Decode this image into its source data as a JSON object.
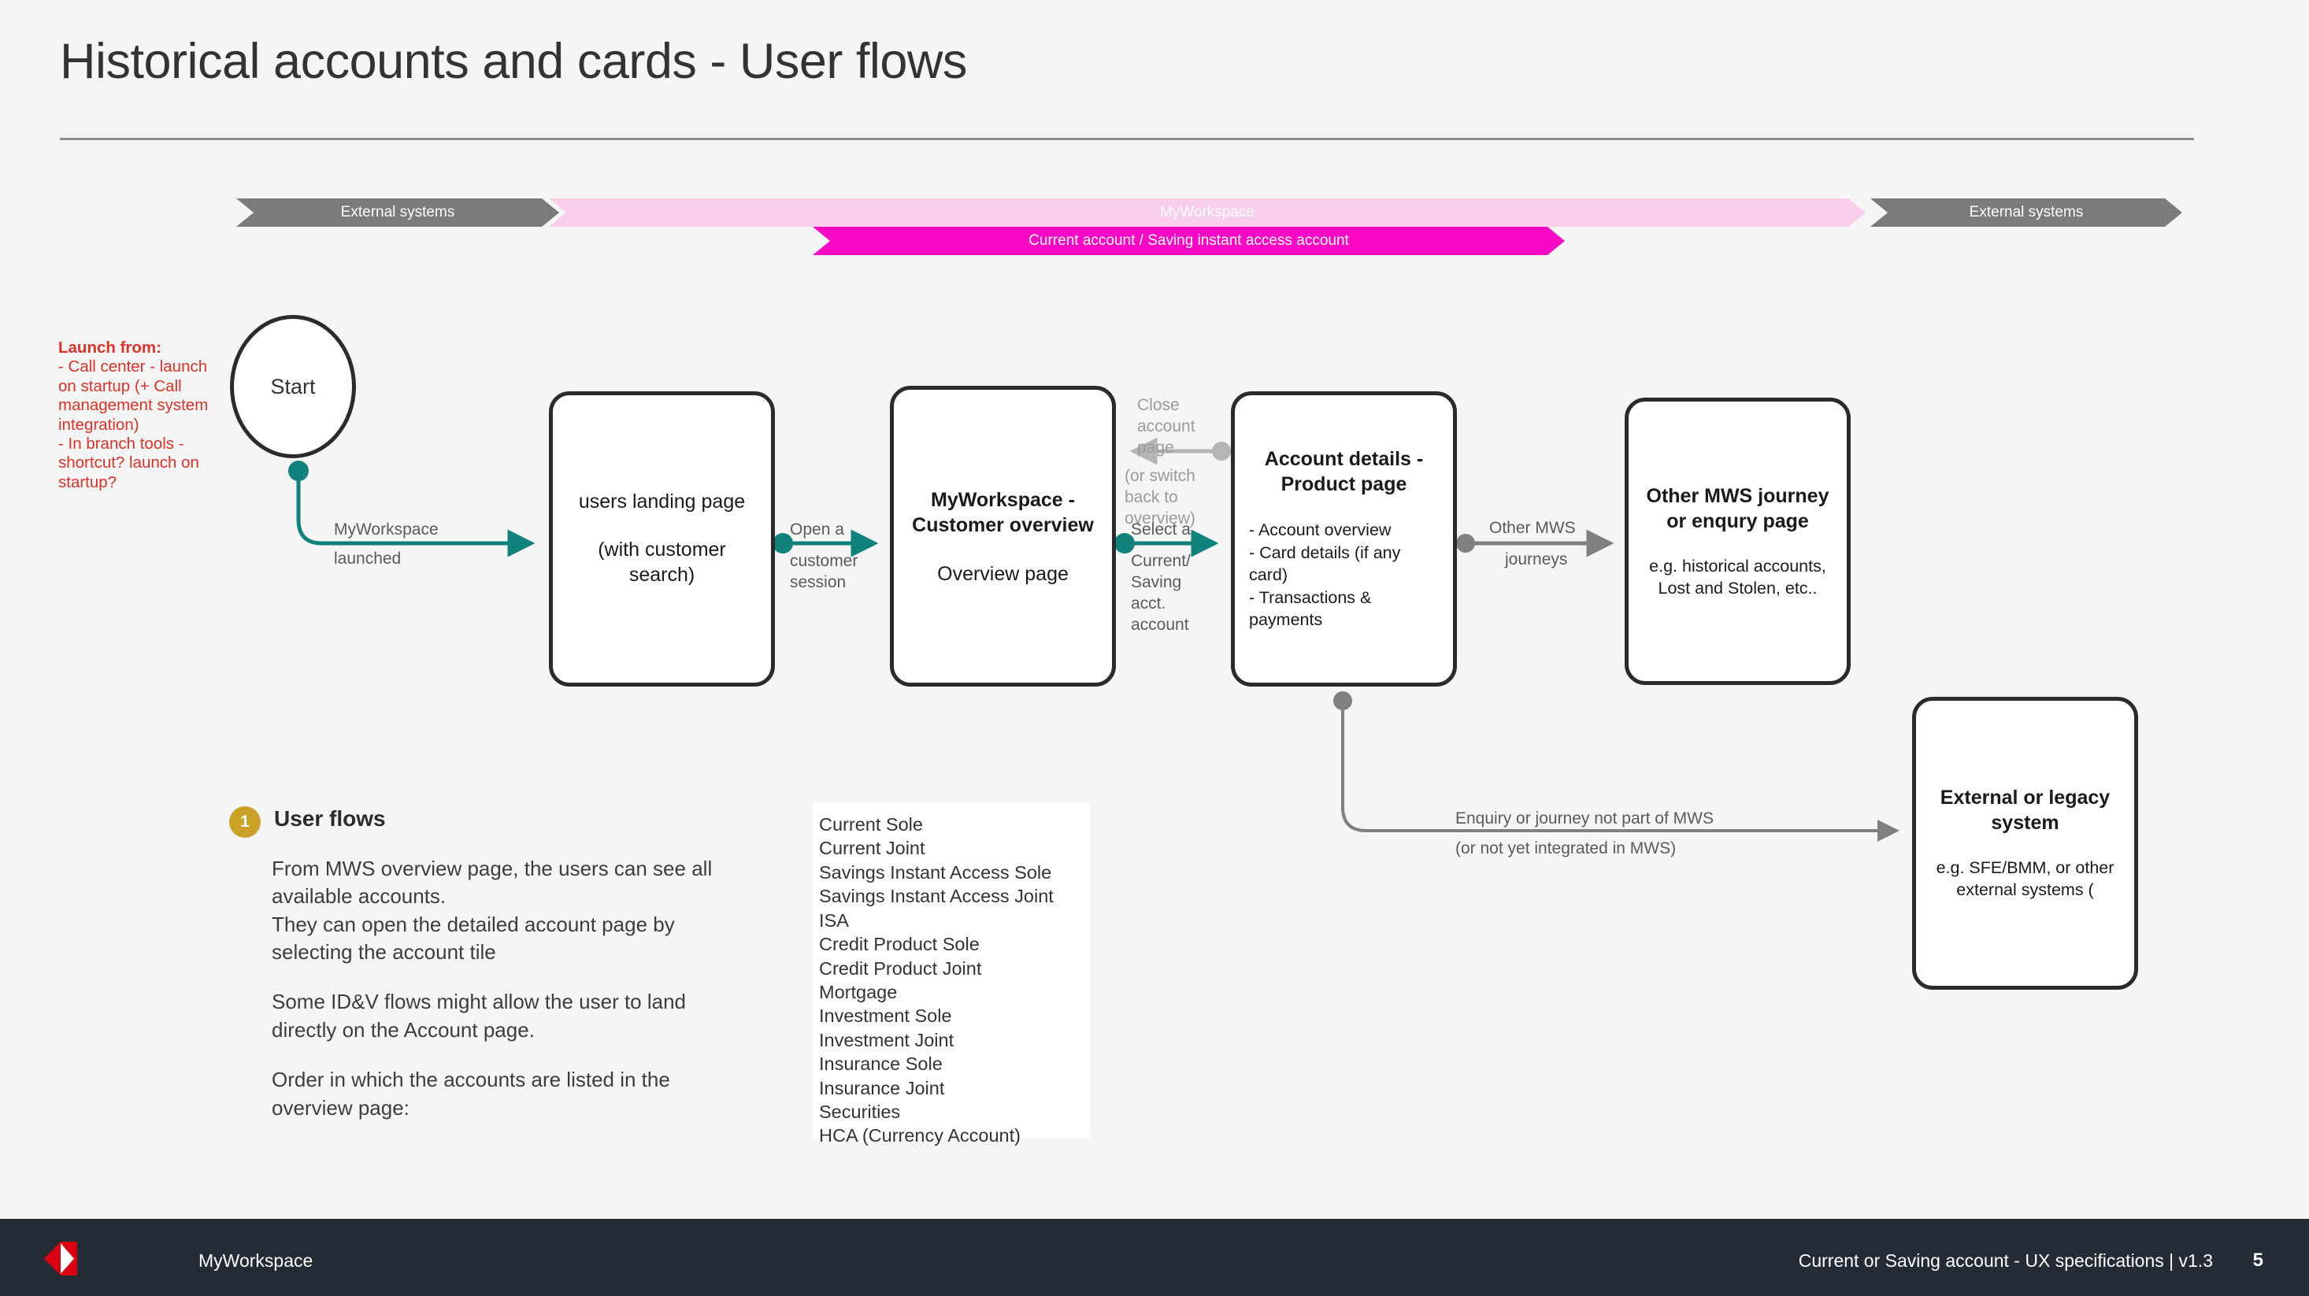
{
  "slide": {
    "title": "Historical accounts and cards - User flows"
  },
  "lanes": {
    "external_left": "External systems",
    "myworkspace": "MyWorkspace",
    "external_right": "External systems",
    "product": "Current account / Saving instant access account",
    "colors": {
      "external": "#7b7b7b",
      "myworkspace": "#f9cdec",
      "product": "#f909c6"
    }
  },
  "launch_note": {
    "heading": "Launch from:",
    "lines": [
      "- Call center - launch on startup (+ Call management system integration)",
      "- In branch tools - shortcut?  launch on startup?"
    ],
    "color": "#e03127"
  },
  "start": {
    "label": "Start"
  },
  "boxes": {
    "landing": {
      "title": "users landing page",
      "subtitle": "(with customer search)"
    },
    "overview": {
      "title": "MyWorkspace - Customer overview",
      "subtitle": "Overview page"
    },
    "details": {
      "title": "Account details - Product page",
      "bullets": [
        "- Account overview",
        "- Card details (if any card)",
        "- Transactions & payments"
      ]
    },
    "journey": {
      "title": "Other MWS journey or enqury page",
      "subtitle": "e.g. historical accounts, Lost and Stolen, etc.."
    },
    "external": {
      "title": "External or legacy system",
      "subtitle": "e.g. SFE/BMM, or other external systems ("
    }
  },
  "connectors": {
    "launched_top": "MyWorkspace",
    "launched_bottom": "launched",
    "open_top": "Open a",
    "open_bottom": "customer session",
    "close_top": "Close account page",
    "close_bottom": "(or switch back to overview)",
    "select_top": "Select a",
    "select_bottom": "Current/ Saving acct. account",
    "other_top": "Other MWS",
    "other_bottom": "journeys",
    "enquiry_top": "Enquiry or journey not part of MWS",
    "enquiry_bottom": "(or not yet integrated in MWS)",
    "teal": "#10827b",
    "grey": "#808080",
    "grey_light": "#b5b5b5"
  },
  "annotation": {
    "badge": "1",
    "title": "User flows",
    "paragraphs": [
      "From MWS overview page, the users can see all available accounts.\nThey can open the detailed account page by selecting the account tile",
      "Some ID&V flows might allow the user to land directly on the Account page.",
      "Order in which the accounts are listed in the overview page:"
    ],
    "badge_color": "#c9a227"
  },
  "account_list": [
    "Current Sole",
    "Current Joint",
    "Savings Instant Access Sole",
    "Savings Instant Access Joint",
    "ISA",
    "Credit Product Sole",
    "Credit Product Joint",
    "Mortgage",
    "Investment Sole",
    "Investment Joint",
    "Insurance Sole",
    "Insurance Joint",
    "Securities",
    "HCA (Currency Account)"
  ],
  "footer": {
    "brand": "MyWorkspace",
    "doc": "Current or Saving account - UX specifications  |  v1.3",
    "page": "5",
    "logo_red": "#db0011",
    "bar_color": "#242b35"
  }
}
